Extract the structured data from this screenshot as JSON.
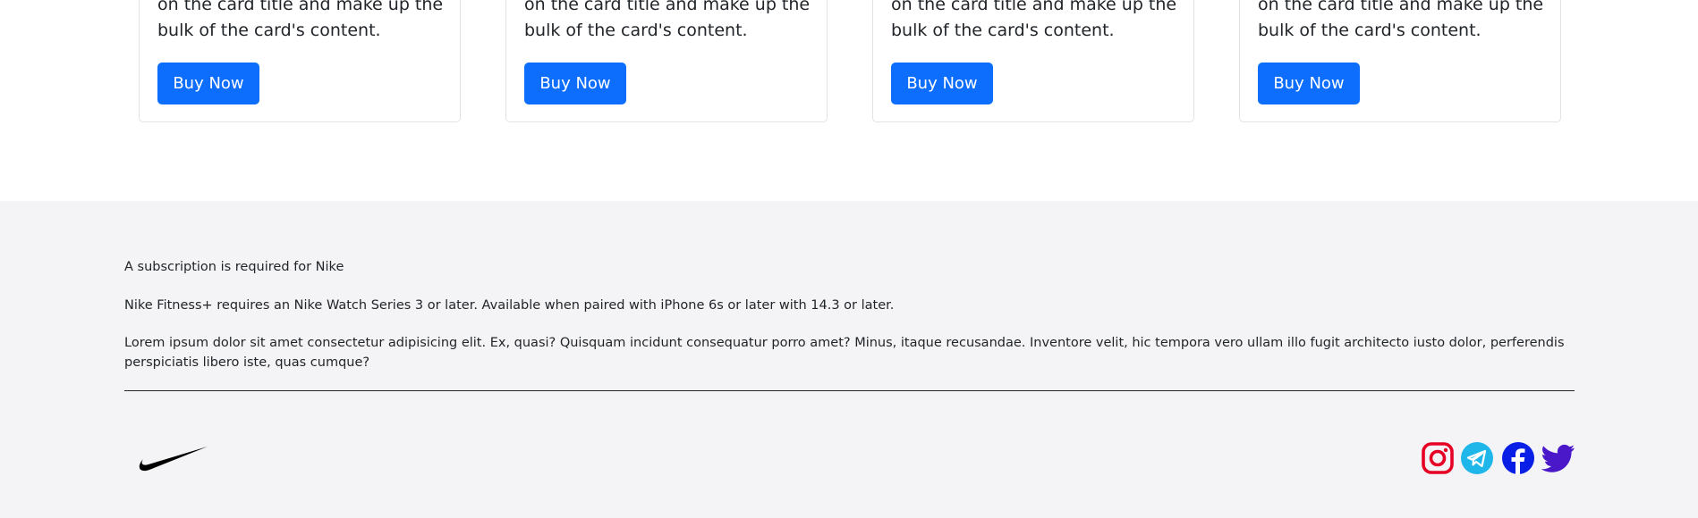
{
  "cards": [
    {
      "text": "on the card title and make up the bulk of the card's content.",
      "button_label": "Buy Now"
    },
    {
      "text": "on the card title and make up the bulk of the card's content.",
      "button_label": "Buy Now"
    },
    {
      "text": "on the card title and make up the bulk of the card's content.",
      "button_label": "Buy Now"
    },
    {
      "text": "on the card title and make up the bulk of the card's content.",
      "button_label": "Buy Now"
    }
  ],
  "footer": {
    "line1": "A subscription is required for Nike",
    "line2": "Nike Fitness+ requires an Nike Watch Series 3 or later. Available when paired with iPhone 6s or later with 14.3 or later.",
    "line3": "Lorem ipsum dolor sit amet consectetur adipisicing elit. Ex, quasi? Quisquam incidunt consequatur porro amet? Minus, itaque recusandae. Inventore velit, hic tempora vero ullam illo fugit architecto iusto dolor, perferendis perspiciatis libero iste, quas cumque?",
    "logo_icon": "nike-swoosh-icon",
    "social_icons": [
      "instagram-icon",
      "telegram-icon",
      "facebook-icon",
      "twitter-icon"
    ]
  },
  "colors": {
    "primary_button": "#0d6efd",
    "footer_background": "#f4f4f6",
    "instagram": "#e60023",
    "telegram": "#1fb6ea",
    "facebook": "#0a1fe6",
    "twitter": "#4a17c9"
  }
}
